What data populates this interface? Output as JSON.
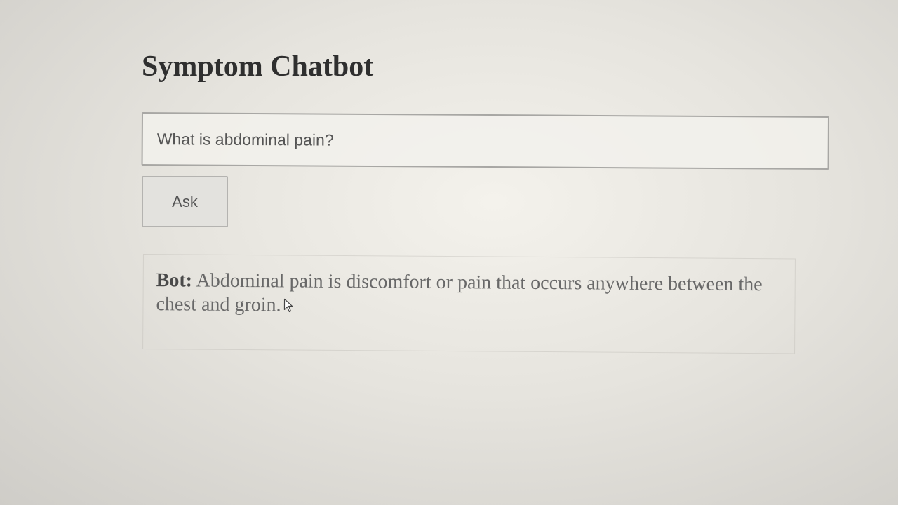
{
  "app": {
    "title": "Symptom Chatbot"
  },
  "question_input": {
    "value": "What is abdominal pain?"
  },
  "ask_button": {
    "label": "Ask"
  },
  "response": {
    "prefix": "Bot:",
    "text": "Abdominal pain is discomfort or pain that occurs anywhere between the chest and groin."
  },
  "icons": {
    "pointer": "mouse-pointer-icon"
  }
}
